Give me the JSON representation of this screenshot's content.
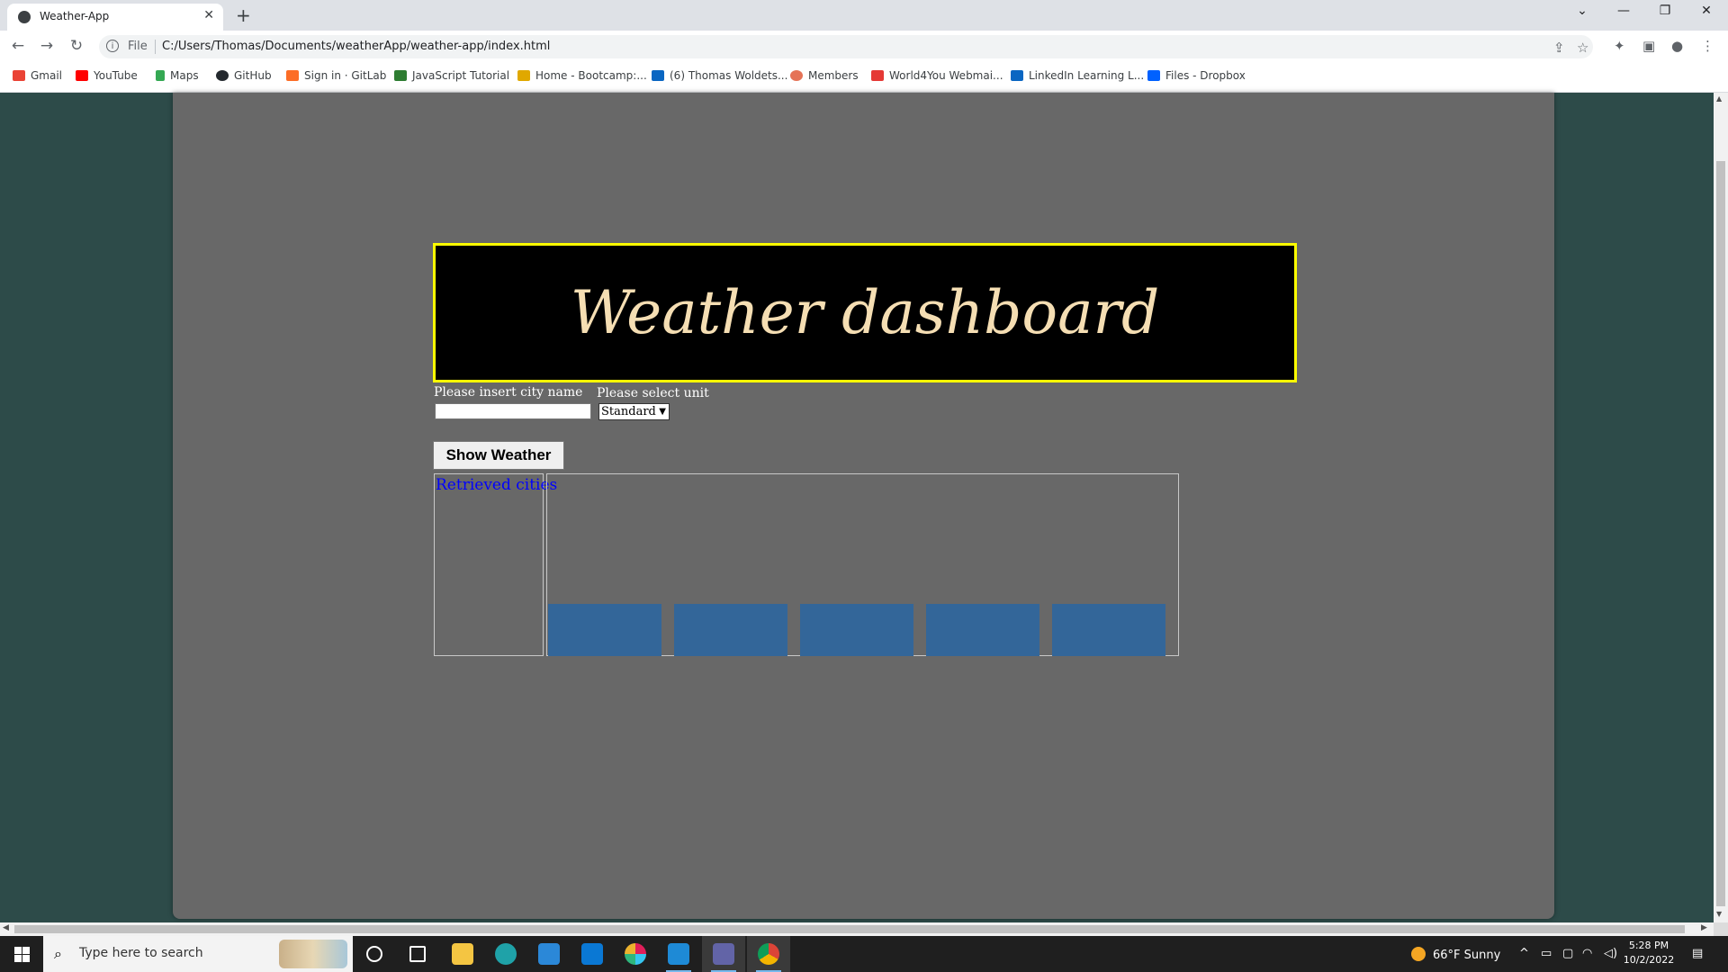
{
  "browser": {
    "tab_title": "Weather-App",
    "file_label": "File",
    "url": "C:/Users/Thomas/Documents/weatherApp/weather-app/index.html",
    "bookmarks": [
      "Gmail",
      "YouTube",
      "Maps",
      "GitHub",
      "Sign in · GitLab",
      "JavaScript Tutorial",
      "Home - Bootcamp:...",
      "(6) Thomas Woldets...",
      "Members",
      "World4You Webmai...",
      "LinkedIn Learning L...",
      "Files - Dropbox"
    ]
  },
  "page": {
    "header_title": "Weather dashboard",
    "city_label": "Please insert city name",
    "city_value": "",
    "unit_label": "Please select unit",
    "unit_selected": "Standard",
    "show_button": "Show Weather",
    "cities_title": "Retrieved cities",
    "forecast_card_count": 5
  },
  "taskbar": {
    "search_placeholder": "Type here to search",
    "weather": "66°F  Sunny",
    "time": "5:28 PM",
    "date": "10/2/2022"
  },
  "colors": {
    "page_bg": "#2d4b49",
    "container_bg": "#686868",
    "header_bg": "#000000",
    "header_border": "#ffff00",
    "header_text": "#f5deb3",
    "cities_title": "#0000ff",
    "forecast_card": "#336699"
  }
}
